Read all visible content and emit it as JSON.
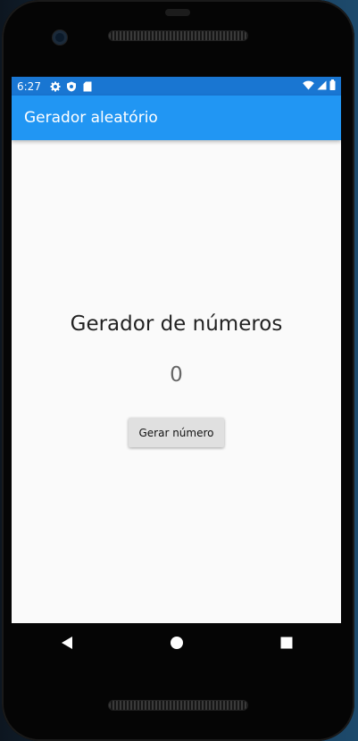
{
  "status_bar": {
    "time": "6:27",
    "left_icons": [
      "gear-icon",
      "shield-icon",
      "sd-card-icon"
    ],
    "right_icons": [
      "wifi-icon",
      "signal-icon",
      "battery-icon"
    ]
  },
  "app_bar": {
    "title": "Gerador aleatório"
  },
  "main": {
    "heading": "Gerador de números",
    "number": "0",
    "button_label": "Gerar número"
  },
  "nav_bar": {
    "buttons": [
      "back-icon",
      "home-icon",
      "recents-icon"
    ]
  },
  "colors": {
    "status_bar": "#1976d2",
    "app_bar": "#2196f3",
    "background": "#fafafa",
    "button": "#e0e0e0"
  }
}
